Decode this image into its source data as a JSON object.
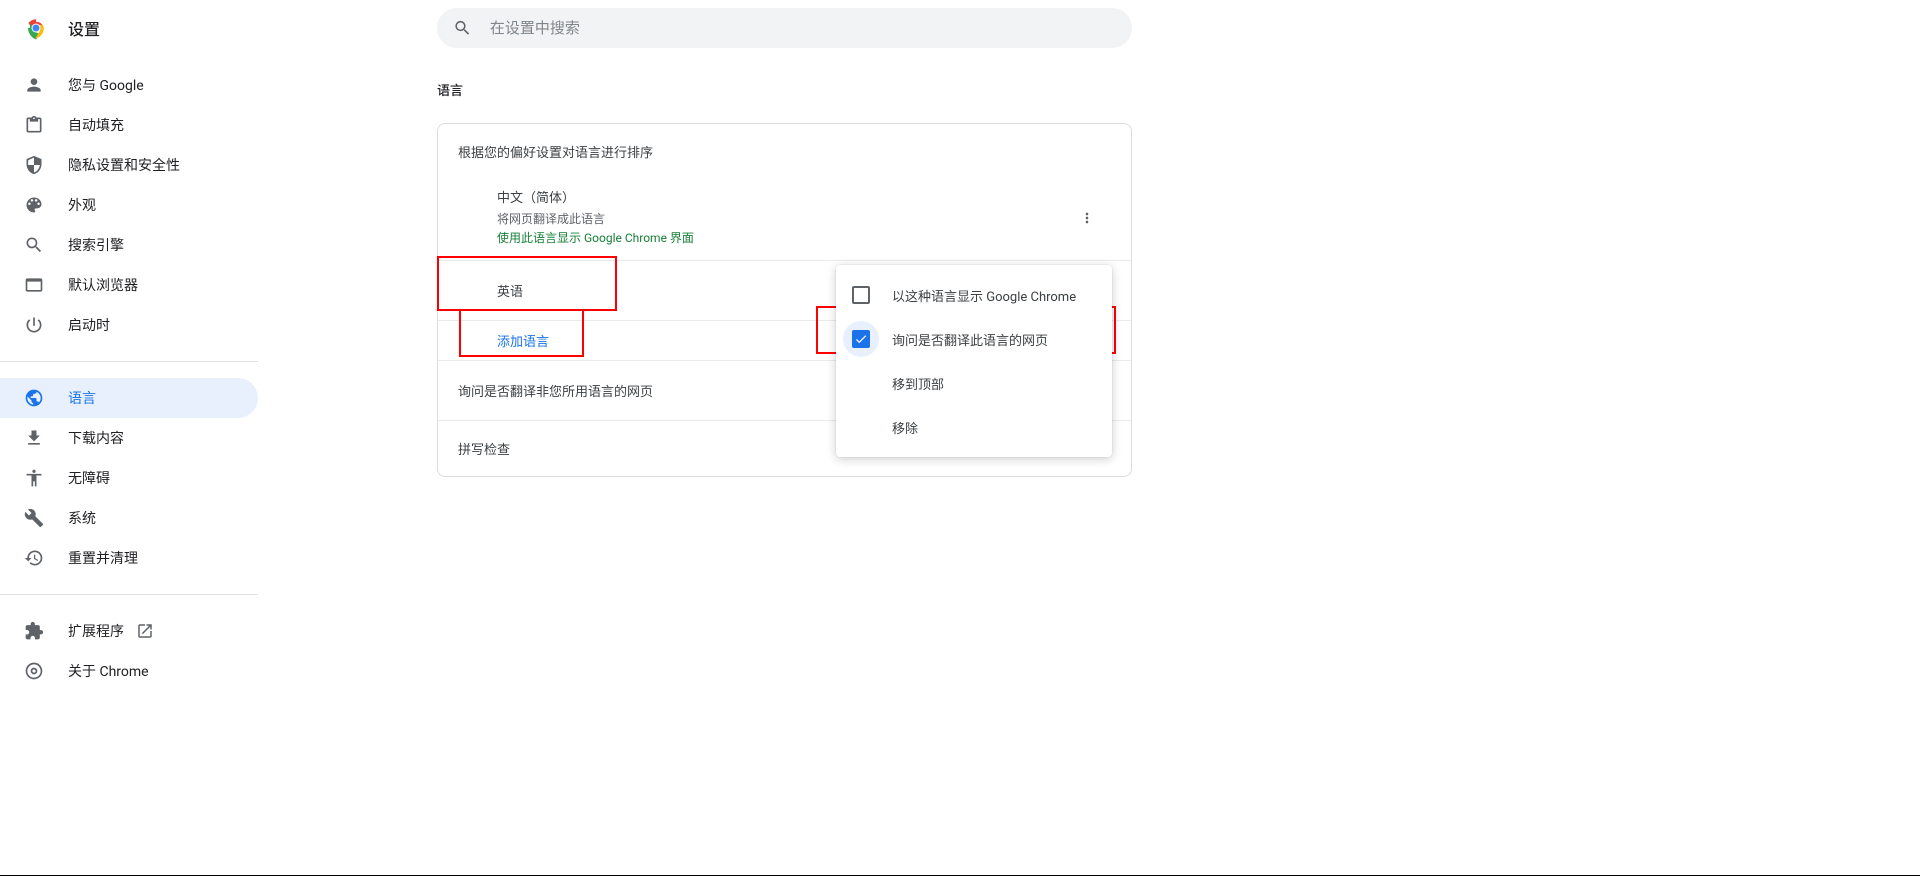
{
  "header": {
    "title": "设置",
    "search_placeholder": "在设置中搜索"
  },
  "sidebar": {
    "items": [
      {
        "label": "您与 Google",
        "active": false
      },
      {
        "label": "自动填充",
        "active": false
      },
      {
        "label": "隐私设置和安全性",
        "active": false
      },
      {
        "label": "外观",
        "active": false
      },
      {
        "label": "搜索引擎",
        "active": false
      },
      {
        "label": "默认浏览器",
        "active": false
      },
      {
        "label": "启动时",
        "active": false
      },
      {
        "label": "语言",
        "active": true
      },
      {
        "label": "下载内容",
        "active": false
      },
      {
        "label": "无障碍",
        "active": false
      },
      {
        "label": "系统",
        "active": false
      },
      {
        "label": "重置并清理",
        "active": false
      }
    ],
    "footer": [
      {
        "label": "扩展程序",
        "external": true
      },
      {
        "label": "关于 Chrome",
        "external": false
      }
    ]
  },
  "main": {
    "section_title": "语言",
    "card": {
      "order_desc": "根据您的偏好设置对语言进行排序",
      "primary_lang": {
        "name": "中文（简体）",
        "translate_to": "将网页翻译成此语言",
        "display_in": "使用此语言显示 Google Chrome 界面"
      },
      "second_lang": "英语",
      "add_language": "添加语言",
      "ask_translate": "询问是否翻译非您所用语言的网页",
      "spellcheck": "拼写检查"
    }
  },
  "popup": {
    "display_chrome": "以这种语言显示 Google Chrome",
    "ask_translate_this": "询问是否翻译此语言的网页",
    "move_top": "移到顶部",
    "remove": "移除"
  }
}
